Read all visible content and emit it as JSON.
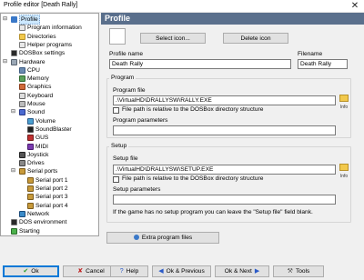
{
  "window": {
    "title": "Profile editor [Death Rally]",
    "close": "✕"
  },
  "tree": {
    "items": [
      {
        "label": "Profile",
        "depth": 0,
        "icon": "profile",
        "expand": "⊟",
        "selected": true
      },
      {
        "label": "Program information",
        "depth": 1,
        "icon": "doc"
      },
      {
        "label": "Directories",
        "depth": 1,
        "icon": "folder"
      },
      {
        "label": "Helper programs",
        "depth": 1,
        "icon": "doc"
      },
      {
        "label": "DOSBox settings",
        "depth": 0,
        "icon": "dosbox"
      },
      {
        "label": "Hardware",
        "depth": 0,
        "icon": "hw",
        "expand": "⊟"
      },
      {
        "label": "CPU",
        "depth": 1,
        "icon": "cpu"
      },
      {
        "label": "Memory",
        "depth": 1,
        "icon": "mem"
      },
      {
        "label": "Graphics",
        "depth": 1,
        "icon": "gfx"
      },
      {
        "label": "Keyboard",
        "depth": 1,
        "icon": "kbd"
      },
      {
        "label": "Mouse",
        "depth": 1,
        "icon": "mouse"
      },
      {
        "label": "Sound",
        "depth": 1,
        "icon": "sound",
        "expand": "⊟"
      },
      {
        "label": "Volume",
        "depth": 2,
        "icon": "vol"
      },
      {
        "label": "SoundBlaster",
        "depth": 2,
        "icon": "sb"
      },
      {
        "label": "GUS",
        "depth": 2,
        "icon": "gus"
      },
      {
        "label": "MIDI",
        "depth": 2,
        "icon": "midi"
      },
      {
        "label": "Joystick",
        "depth": 1,
        "icon": "joy"
      },
      {
        "label": "Drives",
        "depth": 1,
        "icon": "drives"
      },
      {
        "label": "Serial ports",
        "depth": 1,
        "icon": "serial",
        "expand": "⊟"
      },
      {
        "label": "Serial port 1",
        "depth": 2,
        "icon": "serial"
      },
      {
        "label": "Serial port 2",
        "depth": 2,
        "icon": "serial"
      },
      {
        "label": "Serial port 3",
        "depth": 2,
        "icon": "serial"
      },
      {
        "label": "Serial port 4",
        "depth": 2,
        "icon": "serial"
      },
      {
        "label": "Network",
        "depth": 1,
        "icon": "net"
      },
      {
        "label": "DOS environment",
        "depth": 0,
        "icon": "env"
      },
      {
        "label": "Starting",
        "depth": 0,
        "icon": "start"
      }
    ]
  },
  "panel": {
    "header": "Profile",
    "select_icon_label": "Select icon...",
    "delete_icon_label": "Delete icon",
    "profile_name_label": "Profile name",
    "profile_name_value": "Death Rally",
    "filename_label": "Filename",
    "filename_value": "Death Rally",
    "program": {
      "group_title": "Program",
      "file_label": "Program file",
      "file_value": ".\\VirtualHD\\DRALLYSW\\RALLY.EXE",
      "relative_label": "File path is relative to the DOSBox directory structure",
      "params_label": "Program parameters",
      "params_value": "",
      "info": "Info"
    },
    "setup": {
      "group_title": "Setup",
      "file_label": "Setup file",
      "file_value": ".\\VirtualHD\\DRALLYSW\\SETUP.EXE",
      "relative_label": "File path is relative to the DOSBox directory structure",
      "params_label": "Setup parameters",
      "params_value": "",
      "info": "Info",
      "hint": "If the game has no setup program you can leave the \"Setup file\" field blank."
    },
    "extra_files_label": "Extra program files"
  },
  "footer": {
    "ok": "Ok",
    "cancel": "Cancel",
    "help": "Help",
    "ok_prev": "Ok & Previous",
    "ok_next": "Ok & Next",
    "tools": "Tools"
  }
}
